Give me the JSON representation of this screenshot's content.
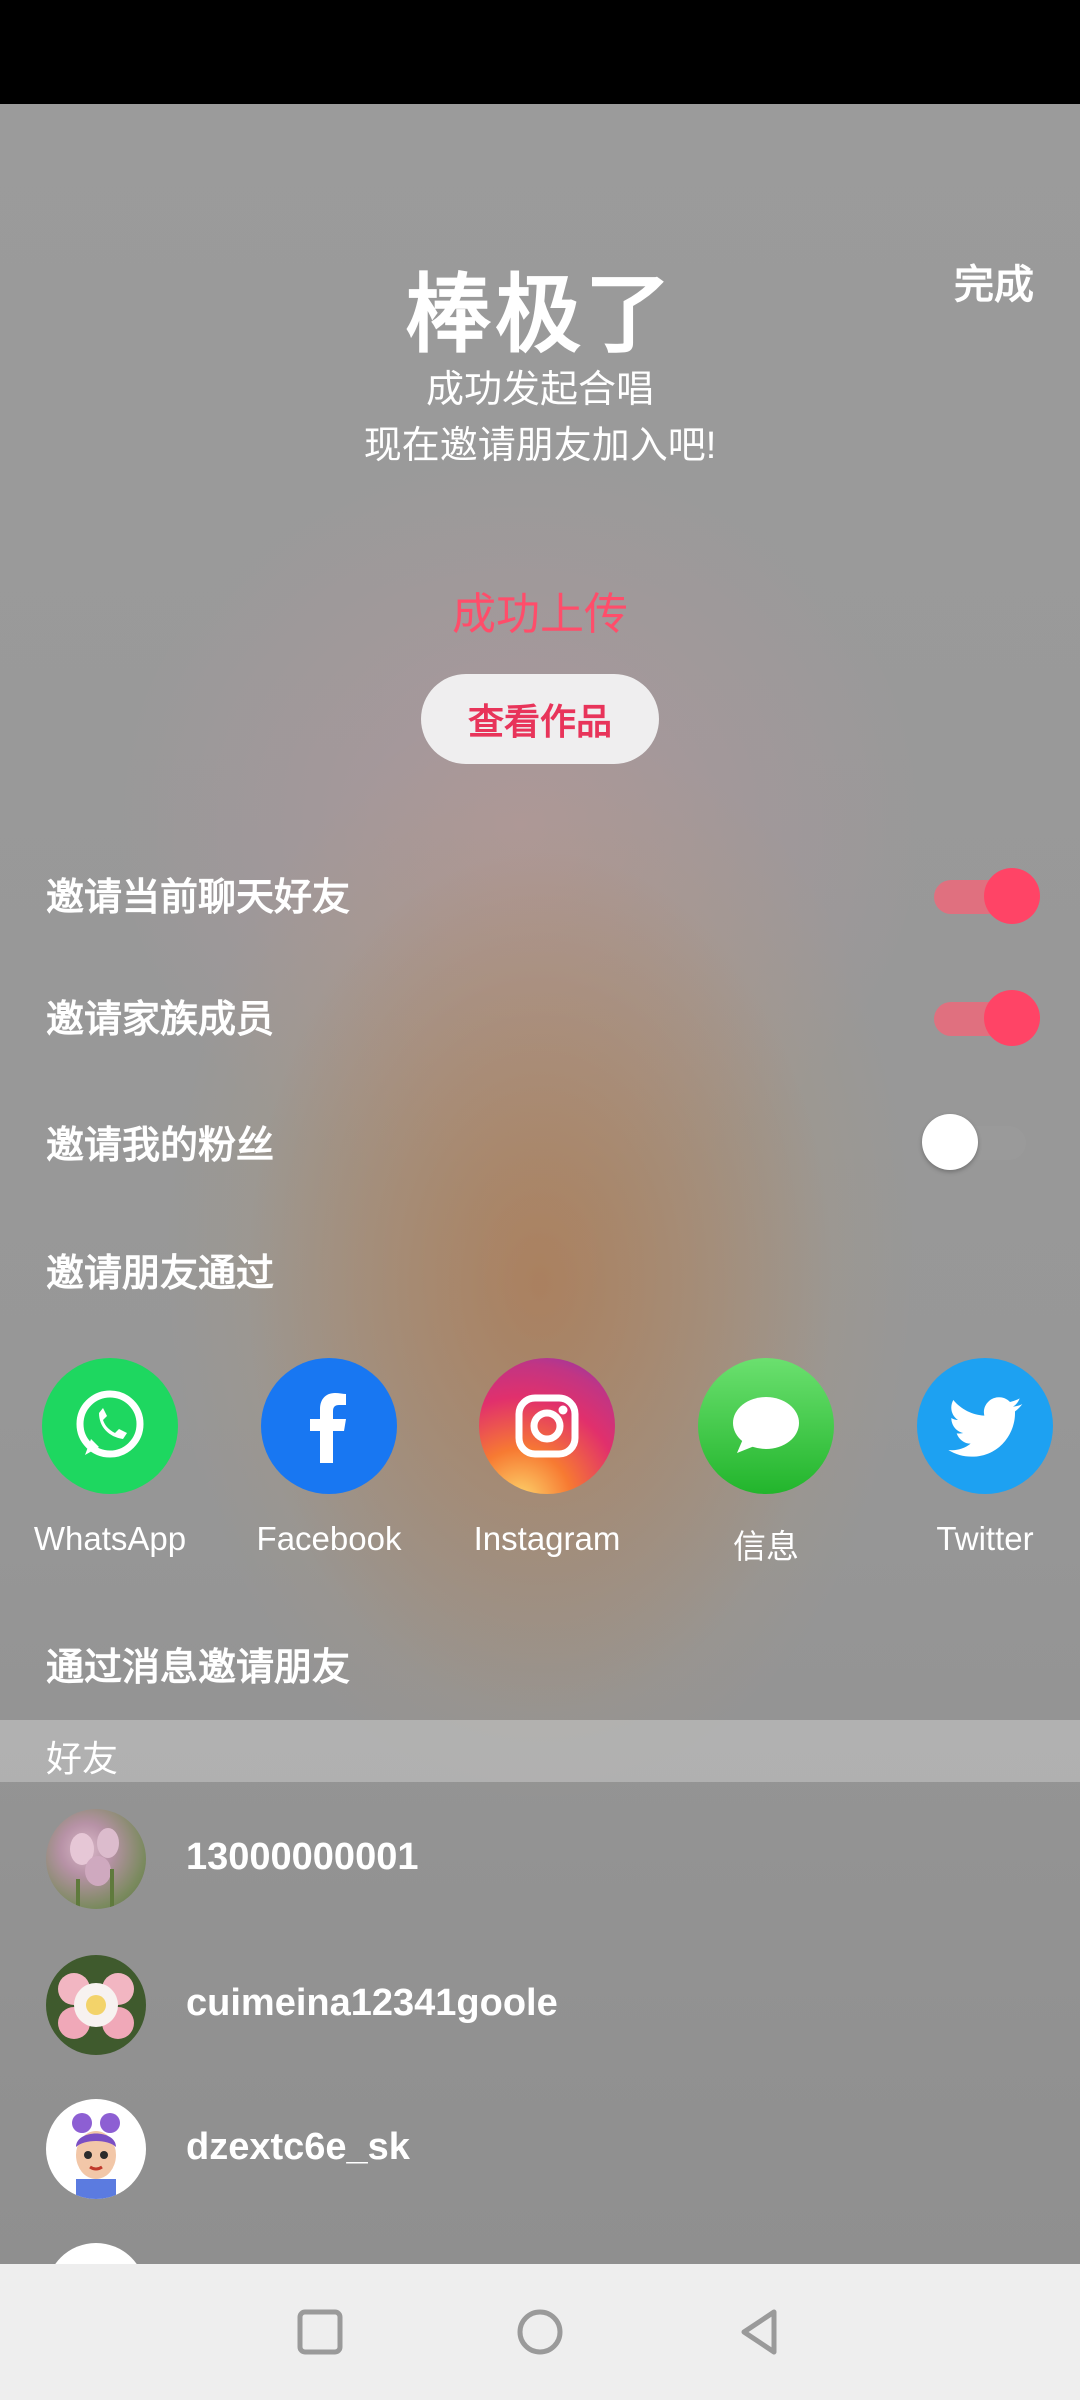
{
  "header": {
    "done_label": "完成",
    "title": "棒极了",
    "subtitle_line1": "成功发起合唱",
    "subtitle_line2": "现在邀请朋友加入吧!"
  },
  "upload": {
    "status": "成功上传",
    "view_button": "查看作品"
  },
  "invite_options": [
    {
      "label": "邀请当前聊天好友",
      "enabled": true
    },
    {
      "label": "邀请家族成员",
      "enabled": true
    },
    {
      "label": "邀请我的粉丝",
      "enabled": false
    }
  ],
  "share": {
    "heading": "邀请朋友通过",
    "apps": [
      {
        "name": "WhatsApp",
        "icon": "whatsapp-icon",
        "color": "#1ed760"
      },
      {
        "name": "Facebook",
        "icon": "facebook-icon",
        "color": "#1877f2"
      },
      {
        "name": "Instagram",
        "icon": "instagram-icon",
        "color": "#e1306c"
      },
      {
        "name": "信息",
        "icon": "messages-icon",
        "color": "#34c759"
      },
      {
        "name": "Twitter",
        "icon": "twitter-icon",
        "color": "#1da1f2"
      }
    ]
  },
  "message_invite": {
    "heading": "通过消息邀请朋友",
    "section_label": "好友",
    "friends": [
      {
        "name": "13000000001",
        "avatar": "flower-photo-avatar"
      },
      {
        "name": "cuimeina12341goole",
        "avatar": "flower-photo-avatar"
      },
      {
        "name": "dzextc6e_sk",
        "avatar": "cartoon-avatar"
      }
    ]
  },
  "navigation": {
    "buttons": [
      "recents-square-icon",
      "home-circle-icon",
      "back-triangle-icon"
    ]
  }
}
